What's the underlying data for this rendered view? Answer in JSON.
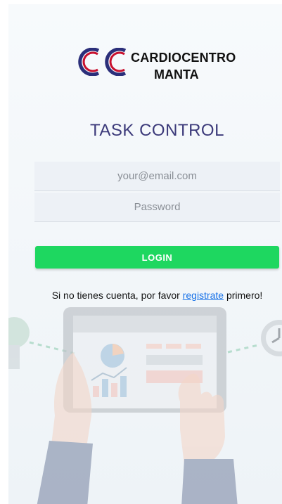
{
  "brand": {
    "line1": "CARDIOCENTRO",
    "line2": "MANTA",
    "logo_color": "#c8102e",
    "logo_secondary_color": "#2b2f7a"
  },
  "title": "TASK CONTROL",
  "form": {
    "email_placeholder": "your@email.com",
    "password_placeholder": "Password",
    "login_label": "LOGIN"
  },
  "register": {
    "prefix": "Si no tienes cuenta, por favor ",
    "link_label": "registrate",
    "suffix": " primero!"
  },
  "colors": {
    "accent": "#1ed760",
    "title": "#3c3a7a",
    "link": "#1a73e8"
  }
}
